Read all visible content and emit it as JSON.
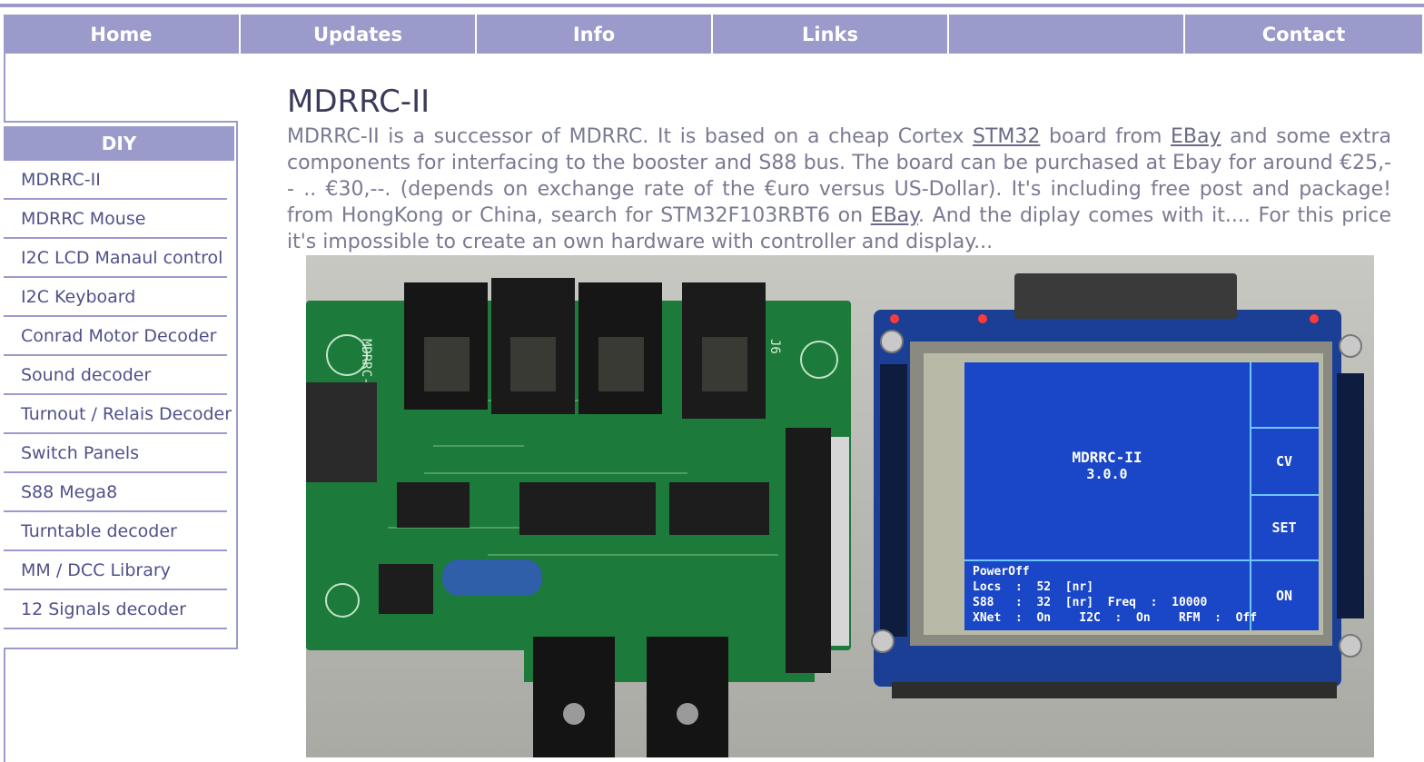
{
  "nav": {
    "items": [
      "Home",
      "Updates",
      "Info",
      "Links",
      "",
      "Contact"
    ]
  },
  "sidebar": {
    "header": "DIY",
    "items": [
      {
        "label": "MDRRC-II"
      },
      {
        "label": "MDRRC Mouse"
      },
      {
        "label": "I2C LCD Manaul control"
      },
      {
        "label": "I2C Keyboard"
      },
      {
        "label": "Conrad Motor Decoder"
      },
      {
        "label": "Sound decoder"
      },
      {
        "label": "Turnout / Relais Decoder"
      },
      {
        "label": "Switch Panels"
      },
      {
        "label": "S88 Mega8"
      },
      {
        "label": "Turntable decoder"
      },
      {
        "label": "MM / DCC Library"
      },
      {
        "label": "12 Signals decoder"
      }
    ]
  },
  "main": {
    "title": "MDRRC-II",
    "intro": {
      "t1": "MDRRC-II is a successor of MDRRC. It is based on a cheap Cortex ",
      "link1": "STM32",
      "t2": " board from ",
      "link2": "EBay",
      "t3": " and some extra components for interfacing to the booster and S88 bus. The board can be purchased at Ebay for around €25,-- .. €30,--. (depends on exchange rate of the €uro versus US-Dollar). It's including free post and package! from HongKong or China, search for STM32F103RBT6 on ",
      "link3": "EBay",
      "t4": ". And the diplay comes with it.... For this price it's impossible to create an own hardware with controller and display..."
    },
    "photo": {
      "silkscreen": "MDRRC-II",
      "connector_label": "J6",
      "lcd": {
        "title": "MDRRC-II",
        "version": "3.0.0",
        "buttons": [
          "CV",
          "SET",
          "ON"
        ],
        "status_lines": [
          "PowerOff",
          "Locs  :  52  [nr]",
          "S88   :  32  [nr]  Freq  :  10000",
          "XNet  :  On    I2C  :  On    RFM  :  Off"
        ]
      }
    }
  },
  "colors": {
    "accent": "#9b9bcb",
    "nav_text": "#ffffff",
    "sidebar_text": "#50508a",
    "body_text": "#7a7a92",
    "title_text": "#3a3a5a",
    "lcd_blue": "#1a46c8"
  }
}
